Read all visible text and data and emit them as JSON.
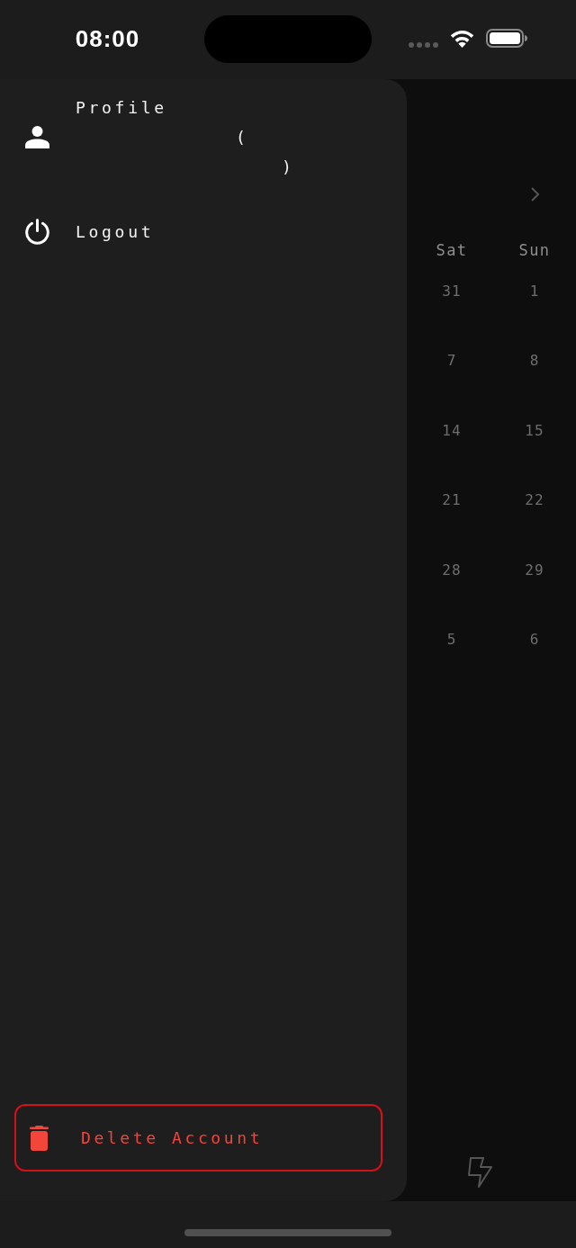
{
  "status_bar": {
    "time": "08:00"
  },
  "drawer": {
    "items": [
      {
        "kind": "profile",
        "label": "Profile",
        "lines": [
          "(",
          ")"
        ]
      },
      {
        "kind": "logout",
        "label": "Logout"
      }
    ],
    "delete_button": {
      "label": "Delete Account"
    }
  },
  "calendar": {
    "weekdays": [
      "Sat",
      "Sun"
    ],
    "weeks": [
      [
        "31",
        "1"
      ],
      [
        "7",
        "8"
      ],
      [
        "14",
        "15"
      ],
      [
        "21",
        "22"
      ],
      [
        "28",
        "29"
      ],
      [
        "5",
        "6"
      ]
    ]
  }
}
